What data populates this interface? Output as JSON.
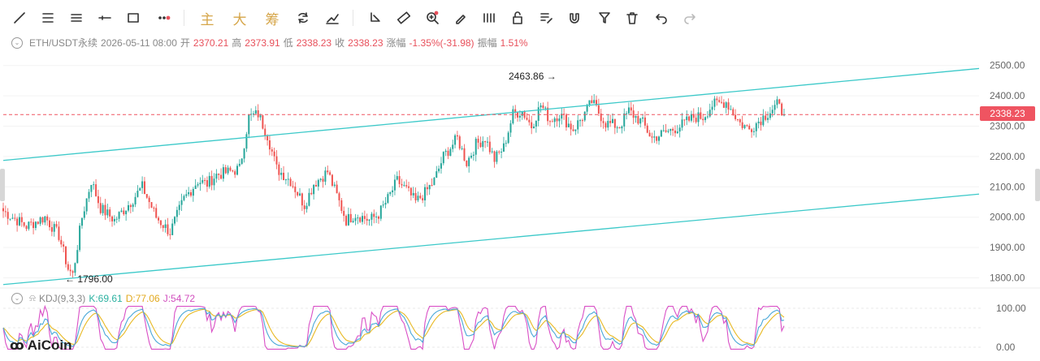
{
  "toolbar": {
    "icons": [
      "line-tool-icon",
      "horizontal-lines-icon",
      "parallel-lines-icon",
      "horizontal-ray-icon",
      "rectangle-icon",
      "more-dots-icon"
    ],
    "gold_labels": [
      "主",
      "大",
      "筹"
    ],
    "right_icons": [
      "rotate-refresh-icon",
      "pen-strike-icon",
      "select-corner-icon",
      "ruler-icon",
      "zoom-in-icon",
      "brush-icon",
      "indicator-icon",
      "lock-icon",
      "edit-list-icon",
      "magnet-icon",
      "filter-icon",
      "trash-icon",
      "undo-icon",
      "redo-icon"
    ]
  },
  "price_info": {
    "symbol": "ETH/USDT永续",
    "datetime": "2026-05-11 08:00",
    "open_label": "开",
    "open": "2370.21",
    "high_label": "高",
    "high": "2373.91",
    "low_label": "低",
    "low": "2338.23",
    "close_label": "收",
    "close": "2338.23",
    "change_label": "涨幅",
    "change": "-1.35%(-31.98)",
    "amp_label": "振幅",
    "amp": "1.51%"
  },
  "kdj_info": {
    "name": "KDJ(9,3,3)",
    "k_label": "K:69.61",
    "d_label": "D:77.06",
    "j_label": "J:54.72"
  },
  "colors": {
    "up": "#26a69a",
    "down": "#ef5350",
    "channel": "#3cc9c9",
    "k": "#4aa8d8",
    "d": "#e8b923",
    "j": "#d94fc6",
    "last": "#ef5461"
  },
  "last_price_label": "2338.23",
  "brand": "AiCoin",
  "chart_data": [
    {
      "type": "candlestick",
      "title": "ETH/USDT永续",
      "y_ticks": [
        1800,
        1900,
        2000,
        2100,
        2200,
        2300,
        2400,
        2500
      ],
      "y_tick_labels": [
        "1800.00",
        "1900.00",
        "2000.00",
        "2100.00",
        "2200.00",
        "2300.00",
        "2400.00",
        "2500.00"
      ],
      "ylim": [
        1780,
        2550
      ],
      "last_price": 2338.23,
      "max_marker": {
        "value": 2463.86,
        "label": "2463.86"
      },
      "min_marker": {
        "value": 1796.0,
        "label": "1796.00"
      },
      "channel": {
        "upper": [
          [
            0,
            2187
          ],
          [
            1,
            2490
          ]
        ],
        "lower": [
          [
            0,
            1778
          ],
          [
            1,
            2076
          ]
        ]
      },
      "trend": [
        [
          0,
          2020
        ],
        [
          10,
          1970
        ],
        [
          18,
          2000
        ],
        [
          24,
          1940
        ],
        [
          28,
          1830
        ],
        [
          30,
          1810
        ],
        [
          34,
          2000
        ],
        [
          38,
          2120
        ],
        [
          42,
          2030
        ],
        [
          48,
          1990
        ],
        [
          55,
          2050
        ],
        [
          60,
          2100
        ],
        [
          66,
          2000
        ],
        [
          72,
          1950
        ],
        [
          78,
          2060
        ],
        [
          84,
          2120
        ],
        [
          88,
          2110
        ],
        [
          92,
          2140
        ],
        [
          98,
          2150
        ],
        [
          102,
          2160
        ],
        [
          106,
          2330
        ],
        [
          110,
          2340
        ],
        [
          114,
          2270
        ],
        [
          118,
          2160
        ],
        [
          124,
          2120
        ],
        [
          130,
          2040
        ],
        [
          134,
          2110
        ],
        [
          140,
          2150
        ],
        [
          144,
          2070
        ],
        [
          148,
          1990
        ],
        [
          152,
          2010
        ],
        [
          158,
          1990
        ],
        [
          162,
          2010
        ],
        [
          166,
          2060
        ],
        [
          170,
          2120
        ],
        [
          174,
          2090
        ],
        [
          178,
          2050
        ],
        [
          182,
          2080
        ],
        [
          186,
          2120
        ],
        [
          190,
          2200
        ],
        [
          196,
          2260
        ],
        [
          200,
          2180
        ],
        [
          204,
          2240
        ],
        [
          208,
          2260
        ],
        [
          212,
          2190
        ],
        [
          216,
          2230
        ],
        [
          220,
          2340
        ],
        [
          224,
          2350
        ],
        [
          228,
          2300
        ],
        [
          232,
          2370
        ],
        [
          236,
          2320
        ],
        [
          240,
          2340
        ],
        [
          246,
          2290
        ],
        [
          250,
          2330
        ],
        [
          254,
          2380
        ],
        [
          260,
          2310
        ],
        [
          266,
          2300
        ],
        [
          270,
          2350
        ],
        [
          276,
          2310
        ],
        [
          280,
          2260
        ],
        [
          286,
          2280
        ],
        [
          292,
          2300
        ],
        [
          298,
          2330
        ],
        [
          302,
          2330
        ],
        [
          306,
          2370
        ],
        [
          312,
          2380
        ],
        [
          318,
          2310
        ],
        [
          322,
          2290
        ],
        [
          328,
          2330
        ],
        [
          334,
          2370
        ],
        [
          337,
          2338
        ]
      ]
    },
    {
      "type": "line",
      "title": "KDJ(9,3,3)",
      "y_ticks": [
        0,
        50,
        100
      ],
      "y_tick_labels": [
        "0.00",
        "",
        "100.00"
      ],
      "ylim": [
        0,
        100
      ],
      "series": [
        {
          "name": "K",
          "last": 69.61
        },
        {
          "name": "D",
          "last": 77.06
        },
        {
          "name": "J",
          "last": 54.72
        }
      ]
    }
  ]
}
